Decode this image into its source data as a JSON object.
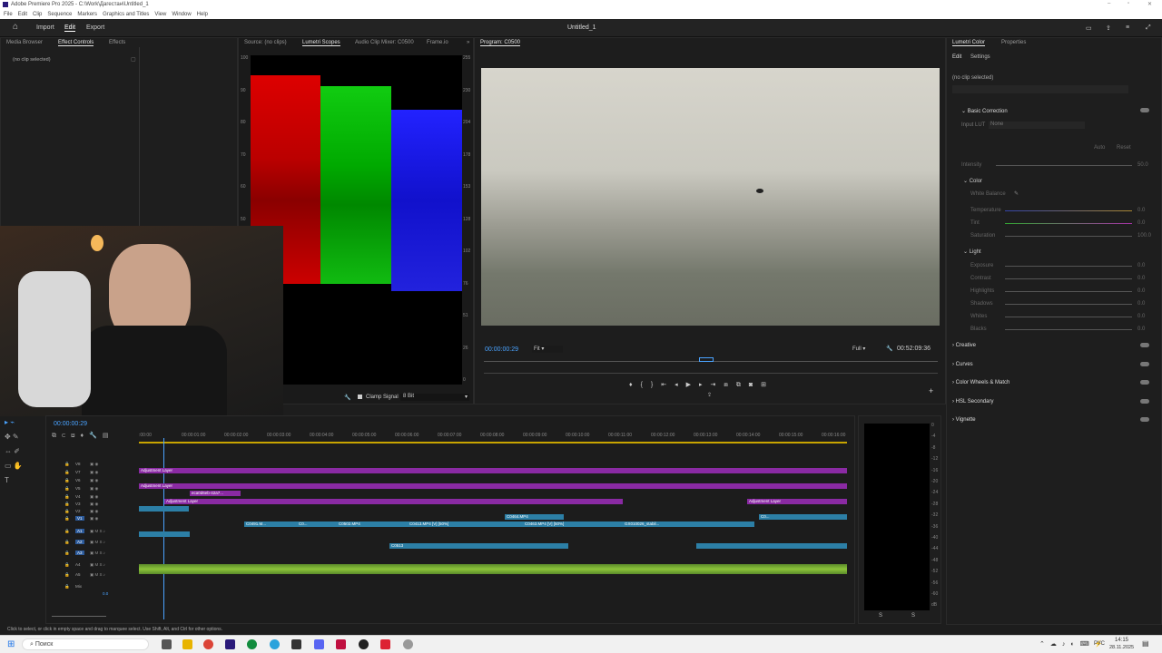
{
  "window": {
    "title": "Adobe Premiere Pro 2025 - C:\\Work\\Дагестан\\Untitled_1"
  },
  "menu": [
    "File",
    "Edit",
    "Clip",
    "Sequence",
    "Markers",
    "Graphics and Titles",
    "View",
    "Window",
    "Help"
  ],
  "appbar": {
    "import": "Import",
    "edit": "Edit",
    "export": "Export",
    "doc_title": "Untitled_1"
  },
  "left_panel": {
    "tabs": [
      "Media Browser",
      "Effect Controls",
      "Effects"
    ],
    "status": "(no clip selected)"
  },
  "scopes_panel": {
    "tabs": [
      "Source: (no clips)",
      "Lumetri Scopes",
      "Audio Clip Mixer: C0500",
      "Frame.io"
    ],
    "left_scale": [
      "100",
      "90",
      "80",
      "70",
      "60",
      "50"
    ],
    "right_scale": [
      "255",
      "230",
      "204",
      "178",
      "153",
      "128",
      "102",
      "76",
      "51",
      "26",
      "0"
    ],
    "clamp": "Clamp Signal",
    "bit": "8 Bit"
  },
  "program": {
    "tab": "Program: C0500",
    "timecode": "00:00:00:29",
    "fit": "Fit",
    "quality": "Full",
    "duration": "00:52:09:36"
  },
  "lumetri": {
    "tabs": [
      "Lumetri Color",
      "Properties"
    ],
    "subtabs": [
      "Edit",
      "Settings"
    ],
    "status": "(no clip selected)",
    "basic": "Basic Correction",
    "input_lut": "Input LUT",
    "lut_value": "None",
    "auto": "Auto",
    "reset": "Reset",
    "intensity": "Intensity",
    "intensity_val": "50.0",
    "color": "Color",
    "white_balance": "White Balance",
    "temp": "Temperature",
    "tint": "Tint",
    "sat": "Saturation",
    "temp_val": "0.0",
    "tint_val": "0.0",
    "sat_val": "100.0",
    "light": "Light",
    "light_rows": [
      "Exposure",
      "Contrast",
      "Highlights",
      "Shadows",
      "Whites",
      "Blacks"
    ],
    "light_vals": [
      "0.0",
      "0.0",
      "0.0",
      "0.0",
      "0.0",
      "0.0"
    ],
    "sections": [
      "Creative",
      "Curves",
      "Color Wheels & Match",
      "HSL Secondary",
      "Vignette"
    ]
  },
  "timeline": {
    "timecode": "00:00:00:29",
    "ruler": [
      ":00:00",
      "00:00:01:00",
      "00:00:02:00",
      "00:00:03:00",
      "00:00:04:00",
      "00:00:05:00",
      "00:00:06:00",
      "00:00:07:00",
      "00:00:08:00",
      "00:00:09:00",
      "00:00:10:00",
      "00:00:11:00",
      "00:00:12:00",
      "00:00:13:00",
      "00:00:14:00",
      "00:00:15:00",
      "00:00:16:00"
    ],
    "tracks": [
      "V8",
      "V7",
      "V6",
      "V5",
      "V4",
      "V3",
      "V2",
      "V1",
      "A1",
      "A2",
      "A3",
      "A4",
      "A5",
      "Mix"
    ],
    "mix_val": "0.0",
    "clips": {
      "adj1": "Adjustment Layer",
      "adj2": "Adjustment Layer",
      "adj3": "Adjustment Layer",
      "adj4": "Adjustment Layer",
      "nested": "eca0d6eb-42a7...",
      "v1a": "C0491.M...",
      "v1b": "C0...",
      "v1c": "C0502.MP4",
      "v1d": "C0413.MP4 [V] [50%]",
      "v1e": "C0463.MP4 [V] [50%]",
      "v1f": "GX010026_stabil...",
      "v2a": "C0464.MP4",
      "v2b": "C0...",
      "a2": "C0513"
    }
  },
  "meter_scale": [
    "0",
    "-4",
    "-8",
    "-12",
    "-16",
    "-20",
    "-24",
    "-28",
    "-32",
    "-36",
    "-40",
    "-44",
    "-48",
    "-52",
    "-56",
    "-60",
    "dB"
  ],
  "meter_bottom": [
    "S",
    "S"
  ],
  "status_bar": "Click to select, or click in empty space and drag to marquee select. Use Shift, Alt, and Ctrl for other options.",
  "taskbar": {
    "search": "Поиск",
    "lang": "РУС",
    "time": "14:15",
    "date": "28.11.2025"
  }
}
